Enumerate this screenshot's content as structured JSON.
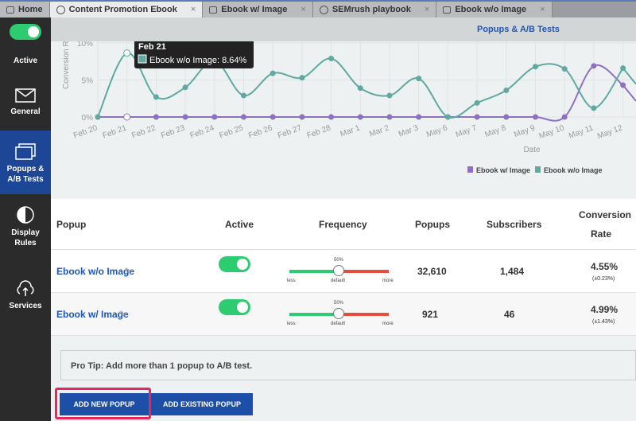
{
  "tabs": [
    {
      "label": "Home",
      "icon": "mail-icon"
    },
    {
      "label": "Content Promotion Ebook",
      "icon": "target-icon",
      "active": true
    },
    {
      "label": "Ebook w/ Image",
      "icon": "window-icon"
    },
    {
      "label": "SEMrush playbook",
      "icon": "target-icon"
    },
    {
      "label": "Ebook w/o Image",
      "icon": "window-icon"
    }
  ],
  "sidebar": {
    "toggle_label": "Active",
    "items": [
      {
        "label": "General"
      },
      {
        "label": "Popups & A/B Tests",
        "active": true
      },
      {
        "label": "Display Rules"
      },
      {
        "label": "Services"
      }
    ]
  },
  "header": {
    "title": "Popups & A/B Tests"
  },
  "chart_data": {
    "type": "line",
    "xlabel": "Date",
    "ylabel": "Conversion Rate",
    "ylim": [
      0,
      10
    ],
    "yticks": [
      "0%",
      "5%",
      "10%"
    ],
    "categories": [
      "Feb 20",
      "Feb 21",
      "Feb 22",
      "Feb 23",
      "Feb 24",
      "Feb 25",
      "Feb 26",
      "Feb 27",
      "Feb 28",
      "Mar 1",
      "Mar 2",
      "Mar 3",
      "May 6",
      "May 7",
      "May 8",
      "May 9",
      "May 10",
      "May 11",
      "May 12"
    ],
    "series": [
      {
        "name": "Ebook w/ Image",
        "color": "#8e6fc0",
        "values": [
          0,
          0,
          0,
          0,
          0,
          0,
          0,
          0,
          0,
          0,
          0,
          0,
          0,
          0,
          0,
          0,
          0,
          6.9,
          4.3
        ]
      },
      {
        "name": "Ebook w/o Image",
        "color": "#5fa9a0",
        "values": [
          0,
          8.64,
          2.7,
          4.0,
          7.6,
          2.9,
          5.9,
          5.3,
          7.9,
          3.9,
          2.9,
          5.2,
          0,
          1.9,
          3.6,
          6.8,
          6.5,
          1.2,
          6.6
        ]
      }
    ],
    "legend": "bottom-right",
    "tooltip": {
      "title": "Feb 21",
      "text": "Ebook w/o Image: 8.64%"
    }
  },
  "table": {
    "headers": [
      "Popup",
      "Active",
      "Frequency",
      "Popups",
      "Subscribers",
      "Conversion",
      "Rate"
    ],
    "slider_labels": {
      "pct": "50%",
      "less": "less",
      "default": "default",
      "more": "more"
    },
    "rows": [
      {
        "name": "Ebook w/o Image",
        "frequency": 50,
        "popups": "32,610",
        "subscribers": "1,484",
        "rate": "4.55%",
        "ci": "(±0.23%)"
      },
      {
        "name": "Ebook w/ Image",
        "frequency": 50,
        "popups": "921",
        "subscribers": "46",
        "rate": "4.99%",
        "ci": "(±1.43%)"
      }
    ]
  },
  "tip": "Pro Tip: Add more than 1 popup to A/B test.",
  "buttons": {
    "add_new": "ADD NEW POPUP",
    "add_existing": "ADD EXISTING POPUP"
  }
}
